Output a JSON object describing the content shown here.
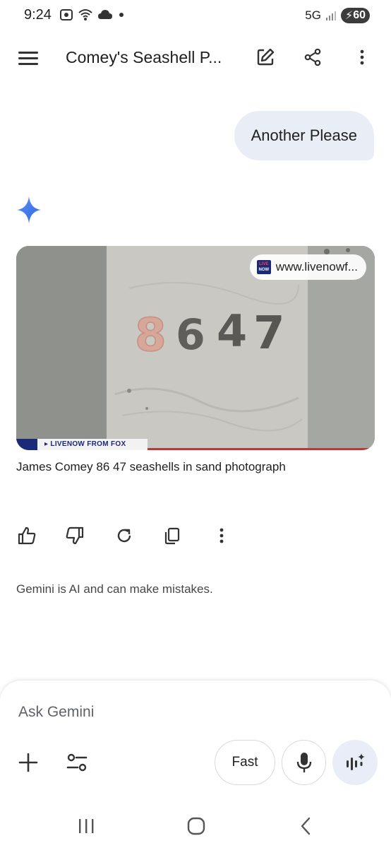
{
  "status_bar": {
    "time": "9:24",
    "network": "5G",
    "battery": "60"
  },
  "app_bar": {
    "title": "Comey's Seashell P..."
  },
  "conversation": {
    "user_message": "Another Please",
    "image_result": {
      "source_url": "www.livenowf...",
      "source_logo_top": "LIVE",
      "source_logo_bottom": "NOW",
      "overlay_text": "LIVENOW FROM FOX",
      "sand_numbers": "8647"
    },
    "caption": "James Comey 86 47 seashells in sand photograph"
  },
  "disclaimer": "Gemini is AI and can make mistakes.",
  "input_panel": {
    "placeholder": "Ask Gemini",
    "mode_label": "Fast"
  },
  "colors": {
    "bubble": "#e9eef6",
    "gemini_spark": "#3b82f6",
    "live_button_bg": "#e8edf7"
  }
}
